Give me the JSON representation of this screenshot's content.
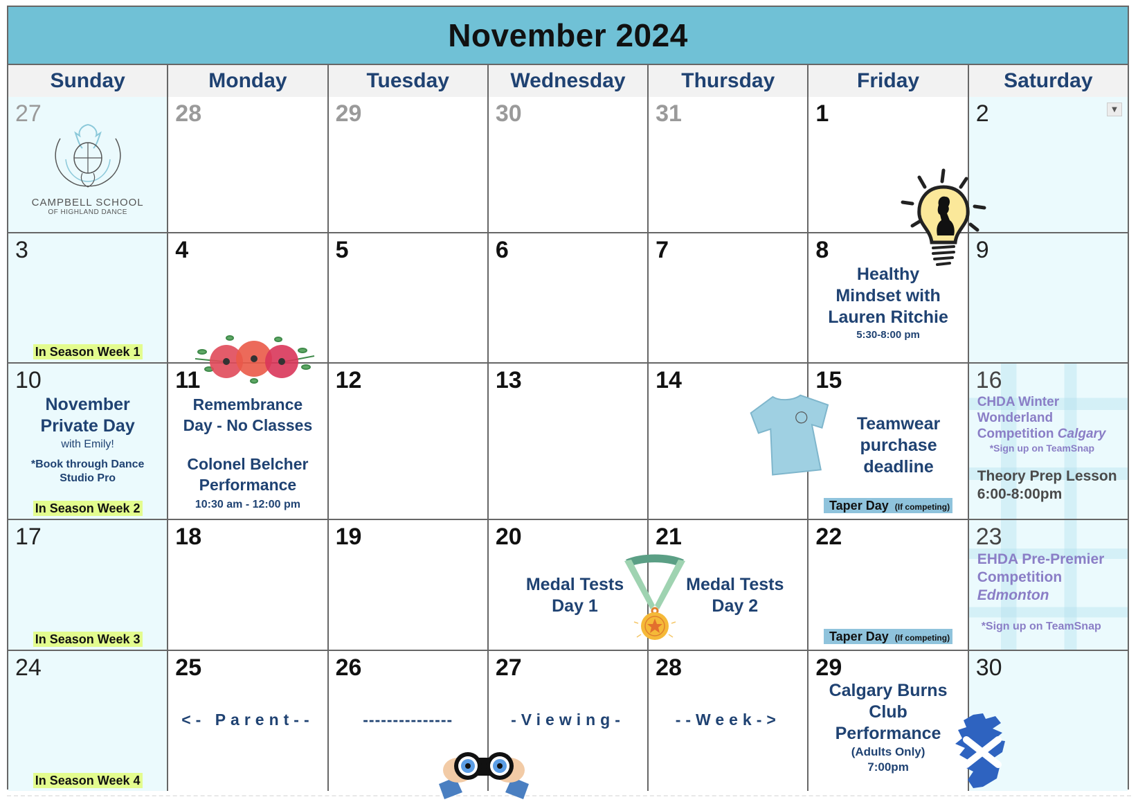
{
  "title": "November 2024",
  "weekdays": [
    "Sunday",
    "Monday",
    "Tuesday",
    "Wednesday",
    "Thursday",
    "Friday",
    "Saturday"
  ],
  "logo": {
    "line1": "CAMPBELL SCHOOL",
    "line2": "OF HIGHLAND DANCE"
  },
  "days": {
    "d27a": "27",
    "d28a": "28",
    "d29a": "29",
    "d30a": "30",
    "d31a": "31",
    "d1": "1",
    "d2": "2",
    "d3": "3",
    "d4": "4",
    "d5": "5",
    "d6": "6",
    "d7": "7",
    "d8": "8",
    "d9": "9",
    "d10": "10",
    "d11": "11",
    "d12": "12",
    "d13": "13",
    "d14": "14",
    "d15": "15",
    "d16": "16",
    "d17": "17",
    "d18": "18",
    "d19": "19",
    "d20": "20",
    "d21": "21",
    "d22": "22",
    "d23": "23",
    "d24": "24",
    "d25": "25",
    "d26": "26",
    "d27": "27",
    "d28": "28",
    "d29": "29",
    "d30": "30"
  },
  "season_weeks": {
    "w1": "In Season Week 1",
    "w2": "In Season Week 2",
    "w3": "In Season Week 3",
    "w4": "In Season Week 4"
  },
  "events": {
    "nov8": {
      "line1": "Healthy",
      "line2": "Mindset with",
      "line3": "Lauren Ritchie",
      "time": "5:30-8:00 pm"
    },
    "nov10": {
      "line1": "November",
      "line2": "Private Day",
      "sub": "with Emily!",
      "note1": "*Book through Dance",
      "note2": "Studio Pro"
    },
    "nov11": {
      "line1": "Remembrance",
      "line2": "Day - No Classes",
      "line3": "Colonel Belcher",
      "line4": "Performance",
      "time": "10:30 am - 12:00 pm"
    },
    "nov15": {
      "line1": "Teamwear",
      "line2": "purchase",
      "line3": "deadline"
    },
    "taper": {
      "label": "Taper Day",
      "note": "(If competing)"
    },
    "nov16": {
      "line1": "CHDA Winter",
      "line2": "Wonderland",
      "line3": "Competition",
      "city": "Calgary",
      "signup": "*Sign up on TeamSnap",
      "lesson": "Theory Prep Lesson",
      "lesson_time": "6:00-8:00pm"
    },
    "nov20": {
      "line1": "Medal Tests",
      "line2": "Day 1"
    },
    "nov21": {
      "line1": "Medal Tests",
      "line2": "Day 2"
    },
    "nov23": {
      "line1": "EHDA Pre-Premier",
      "line2": "Competition",
      "city": "Edmonton",
      "signup": "*Sign up on TeamSnap"
    },
    "parent_week": {
      "p1": "<- Parent--",
      "p2": "---------------",
      "p3": "-Viewing-",
      "p4": "--Week->"
    },
    "nov29": {
      "line1": "Calgary Burns",
      "line2": "Club",
      "line3": "Performance",
      "sub": "(Adults Only)",
      "time": "7:00pm"
    }
  },
  "colors": {
    "title_bar": "#70c1d6",
    "weekday_text": "#1f4272",
    "event_text": "#1f4272",
    "competition_text": "#8a7ec6",
    "season_highlight": "#e3fc8e",
    "taper_highlight": "#8fc3dc",
    "weekend_bg": "#ebfafd"
  }
}
